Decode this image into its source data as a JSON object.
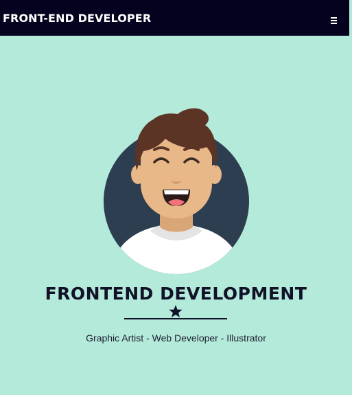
{
  "navbar": {
    "brand": "FRONT-END DEVELOPER",
    "menu_icon": "hamburger-menu-icon"
  },
  "hero": {
    "avatar_icon": "smiling-developer-avatar",
    "title": "FRONTEND DEVELOPMENT",
    "divider_icon": "star-icon",
    "subtitle": "Graphic Artist - Web Developer - Illustrator"
  },
  "colors": {
    "background": "#b3eada",
    "navbar": "#04021e",
    "text_dark": "#111227",
    "avatar_circle": "#2c3e50",
    "skin": "#e9b889",
    "hair": "#5b3426",
    "shirt": "#ffffff"
  }
}
